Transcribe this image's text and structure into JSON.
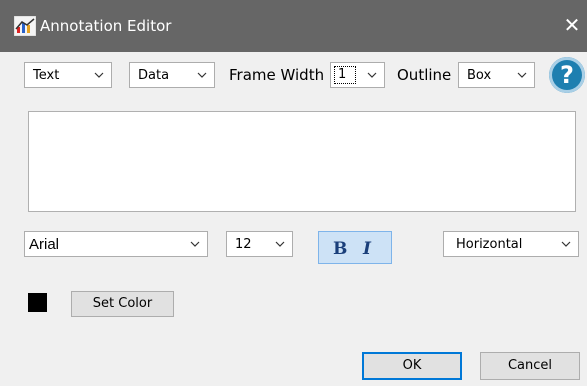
{
  "window": {
    "title": "Annotation Editor",
    "close_glyph": "✕",
    "icon": "chart-app-icon"
  },
  "toolbar": {
    "type_select": "Text",
    "source_select": "Data",
    "frame_width_label": "Frame Width",
    "frame_width_select": "1",
    "outline_label": "Outline",
    "outline_select": "Box",
    "help_glyph": "?"
  },
  "editor": {
    "text_value": ""
  },
  "format": {
    "font_select": "Arial",
    "size_select": "12",
    "bold_glyph": "B",
    "italic_glyph": "I",
    "orientation_select": "Horizontal"
  },
  "color": {
    "swatch_color": "#000000",
    "set_color_label": "Set Color"
  },
  "footer": {
    "ok_label": "OK",
    "cancel_label": "Cancel"
  },
  "theme": {
    "titlebar_color": "#666666",
    "help_color": "#1e7fb0",
    "accent_color": "#0078d7"
  }
}
